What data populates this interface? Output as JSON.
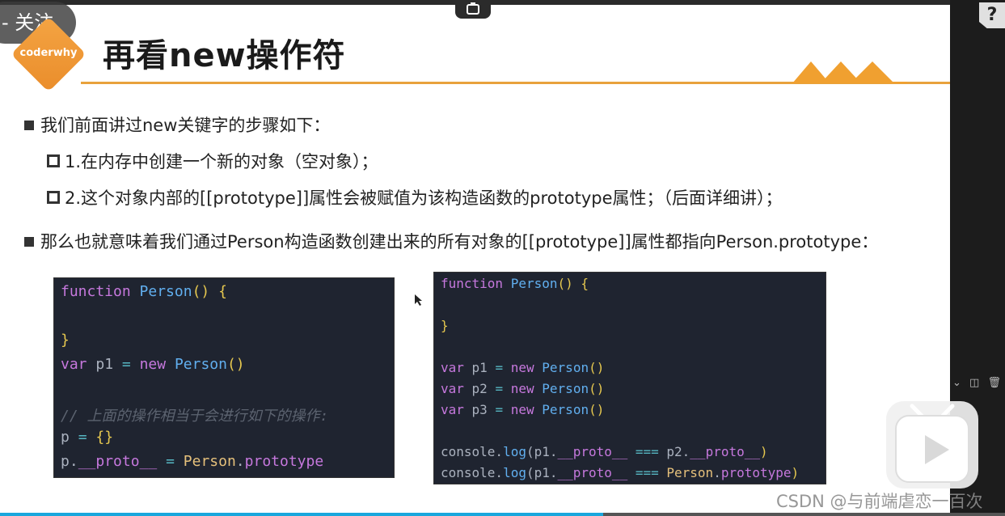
{
  "video": {
    "follow_label": "关注",
    "progress_fraction": 0.6
  },
  "slide": {
    "logo_text": "coderwhy",
    "title": "再看new操作符",
    "bullets": {
      "b1": "我们前面讲过new关键字的步骤如下：",
      "b1_sub1": "1.在内存中创建一个新的对象（空对象）；",
      "b1_sub2": "2.这个对象内部的[[prototype]]属性会被赋值为该构造函数的prototype属性；（后面详细讲）；",
      "b2": "那么也就意味着我们通过Person构造函数创建出来的所有对象的[[prototype]]属性都指向Person.prototype："
    }
  },
  "code_left": {
    "l1_kw": "function",
    "l1_fn": "Person",
    "l1_rest": "() {",
    "l3": "}",
    "l4_kw": "var",
    "l4_var": "p1",
    "l4_eq": "=",
    "l4_new": "new",
    "l4_fn": "Person",
    "l4_paren": "()",
    "l6_comment": "// 上面的操作相当于会进行如下的操作:",
    "l7_var": "p",
    "l7_eq": "=",
    "l7_val": "{}",
    "l8_var": "p",
    "l8_dot": ".",
    "l8_prop": "__proto__",
    "l8_eq": "=",
    "l8_cls": "Person",
    "l8_dot2": ".",
    "l8_prop2": "prototype"
  },
  "code_right": {
    "l1_kw": "function",
    "l1_fn": "Person",
    "l1_rest": "() {",
    "l3": "}",
    "v1_kw": "var",
    "v1_name": "p1",
    "v2_kw": "var",
    "v2_name": "p2",
    "v3_kw": "var",
    "v3_name": "p3",
    "eq": "=",
    "new_kw": "new",
    "fn": "Person",
    "paren": "()",
    "c1": "console.",
    "c1_log": "log",
    "c1_args_a": "(p1.",
    "c1_proto": "__proto__",
    "c1_op": "===",
    "c1_args_b": "p2.",
    "c1_proto2": "__proto__",
    "c1_close": ")",
    "c2": "console.",
    "c2_log": "log",
    "c2_args_a": "(p1.",
    "c2_proto": "__proto__",
    "c2_op": "===",
    "c2_cls": "Person",
    "c2_dot": ".",
    "c2_prop": "prototype",
    "c2_close": ")"
  },
  "overlay": {
    "csdn_watermark": "CSDN @与前端虐恋一百次",
    "help_label": "?"
  },
  "colors": {
    "accent_orange": "#e8a23c",
    "code_bg": "#1f2430",
    "progress_blue": "#19a7dd"
  }
}
